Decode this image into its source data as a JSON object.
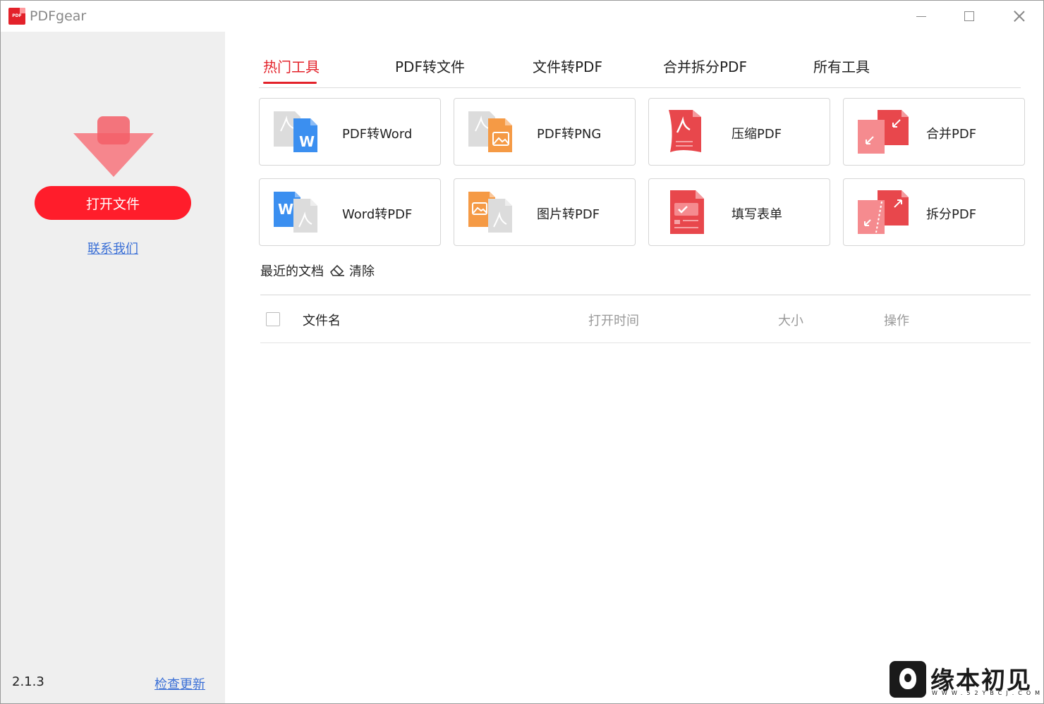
{
  "window": {
    "title": "PDFgear",
    "logo_text": "PDF"
  },
  "sidebar": {
    "open_button": "打开文件",
    "contact": "联系我们",
    "version": "2.1.3",
    "check_update": "检查更新"
  },
  "tabs": [
    {
      "label": "热门工具",
      "active": true
    },
    {
      "label": "PDF转文件",
      "active": false
    },
    {
      "label": "文件转PDF",
      "active": false
    },
    {
      "label": "合并拆分PDF",
      "active": false
    },
    {
      "label": "所有工具",
      "active": false
    }
  ],
  "tools": [
    {
      "label": "PDF转Word",
      "icon": "pdf-to-word-icon"
    },
    {
      "label": "PDF转PNG",
      "icon": "pdf-to-png-icon"
    },
    {
      "label": "压缩PDF",
      "icon": "compress-pdf-icon"
    },
    {
      "label": "合并PDF",
      "icon": "merge-pdf-icon"
    },
    {
      "label": "Word转PDF",
      "icon": "word-to-pdf-icon"
    },
    {
      "label": "图片转PDF",
      "icon": "image-to-pdf-icon"
    },
    {
      "label": "填写表单",
      "icon": "fill-form-icon"
    },
    {
      "label": "拆分PDF",
      "icon": "split-pdf-icon"
    }
  ],
  "recent": {
    "title": "最近的文档",
    "clear": "清除",
    "columns": {
      "name": "文件名",
      "opened": "打开时间",
      "size": "大小",
      "action": "操作"
    },
    "rows": []
  },
  "watermark": {
    "text": "缘本初见",
    "sub": "WWW.52YBCJ.COM"
  },
  "colors": {
    "accent": "#e3222a",
    "open_button": "#ff1d2b",
    "link": "#3a6fd6",
    "sidebar_bg": "#efefef",
    "word_blue": "#3b8ff0",
    "image_orange": "#f59a45",
    "pdf_red": "#e8474c"
  }
}
